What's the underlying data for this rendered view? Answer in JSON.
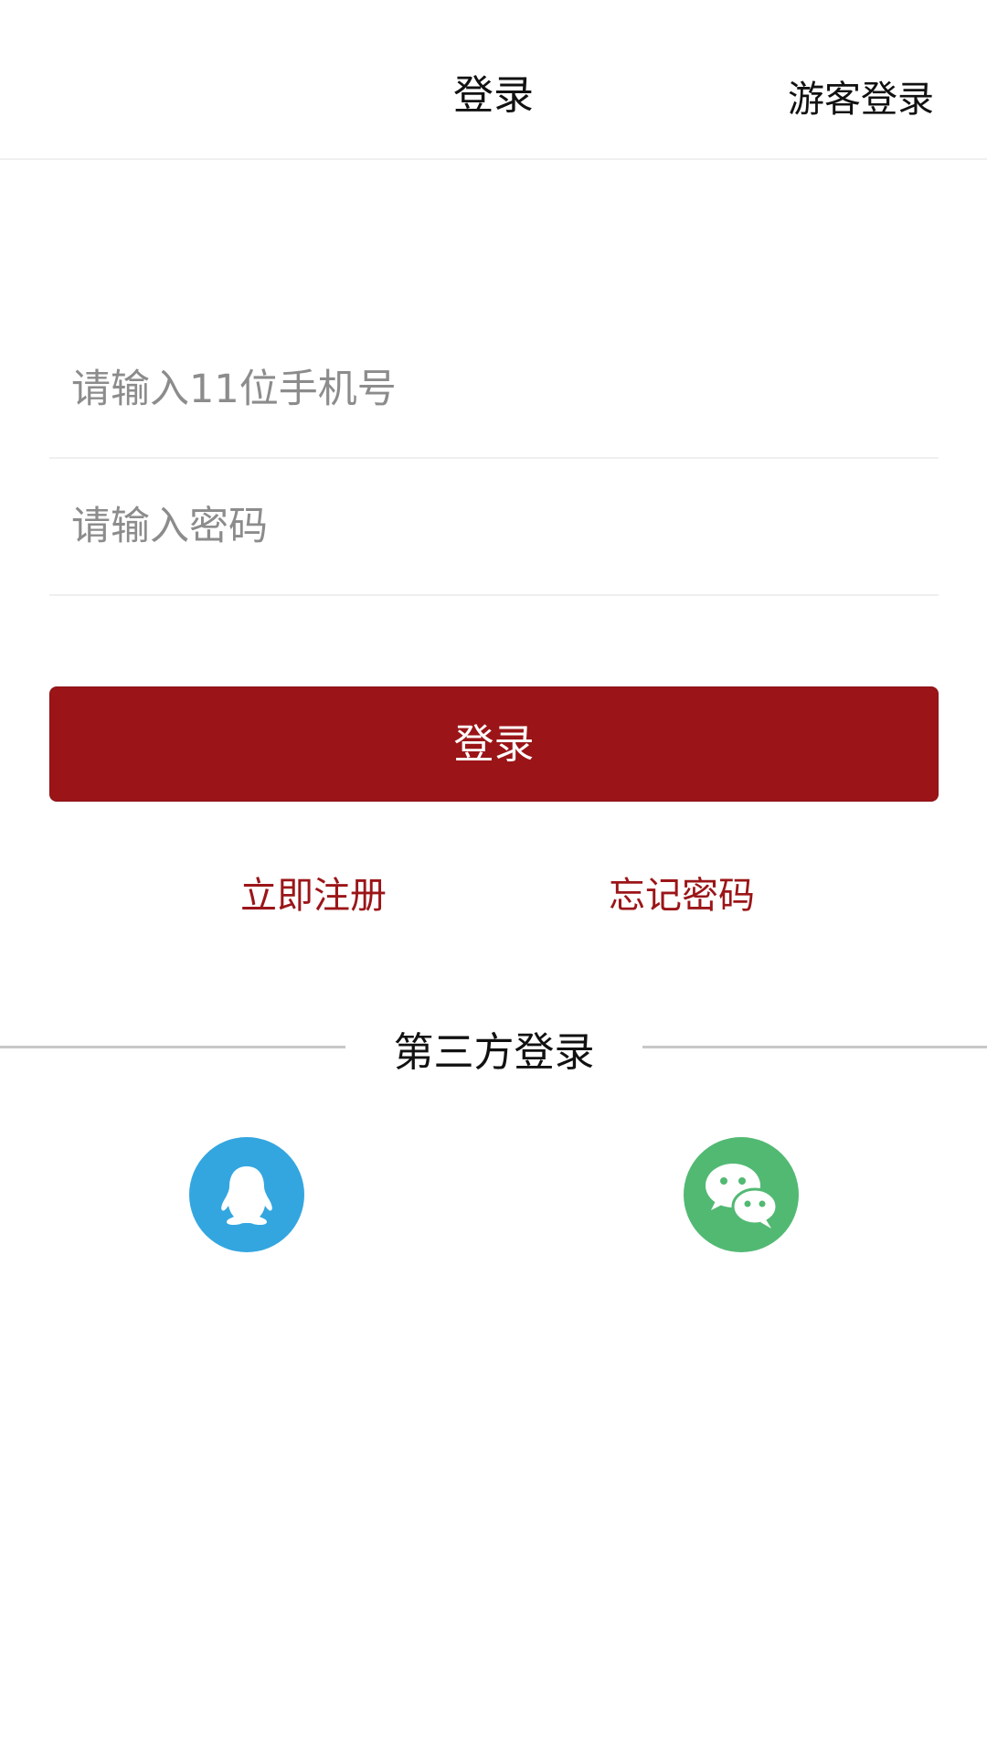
{
  "header": {
    "title": "登录",
    "guest_login": "游客登录"
  },
  "form": {
    "phone_placeholder": "请输入11位手机号",
    "phone_value": "",
    "password_placeholder": "请输入密码",
    "password_value": "",
    "login_label": "登录"
  },
  "links": {
    "register": "立即注册",
    "forgot_password": "忘记密码"
  },
  "third_party": {
    "label": "第三方登录",
    "providers": [
      {
        "icon": "qq-icon",
        "color": "#33a6e0"
      },
      {
        "icon": "wechat-icon",
        "color": "#52b973"
      }
    ]
  },
  "colors": {
    "accent": "#9b1518",
    "qq": "#33a6e0",
    "wechat": "#52b973"
  }
}
